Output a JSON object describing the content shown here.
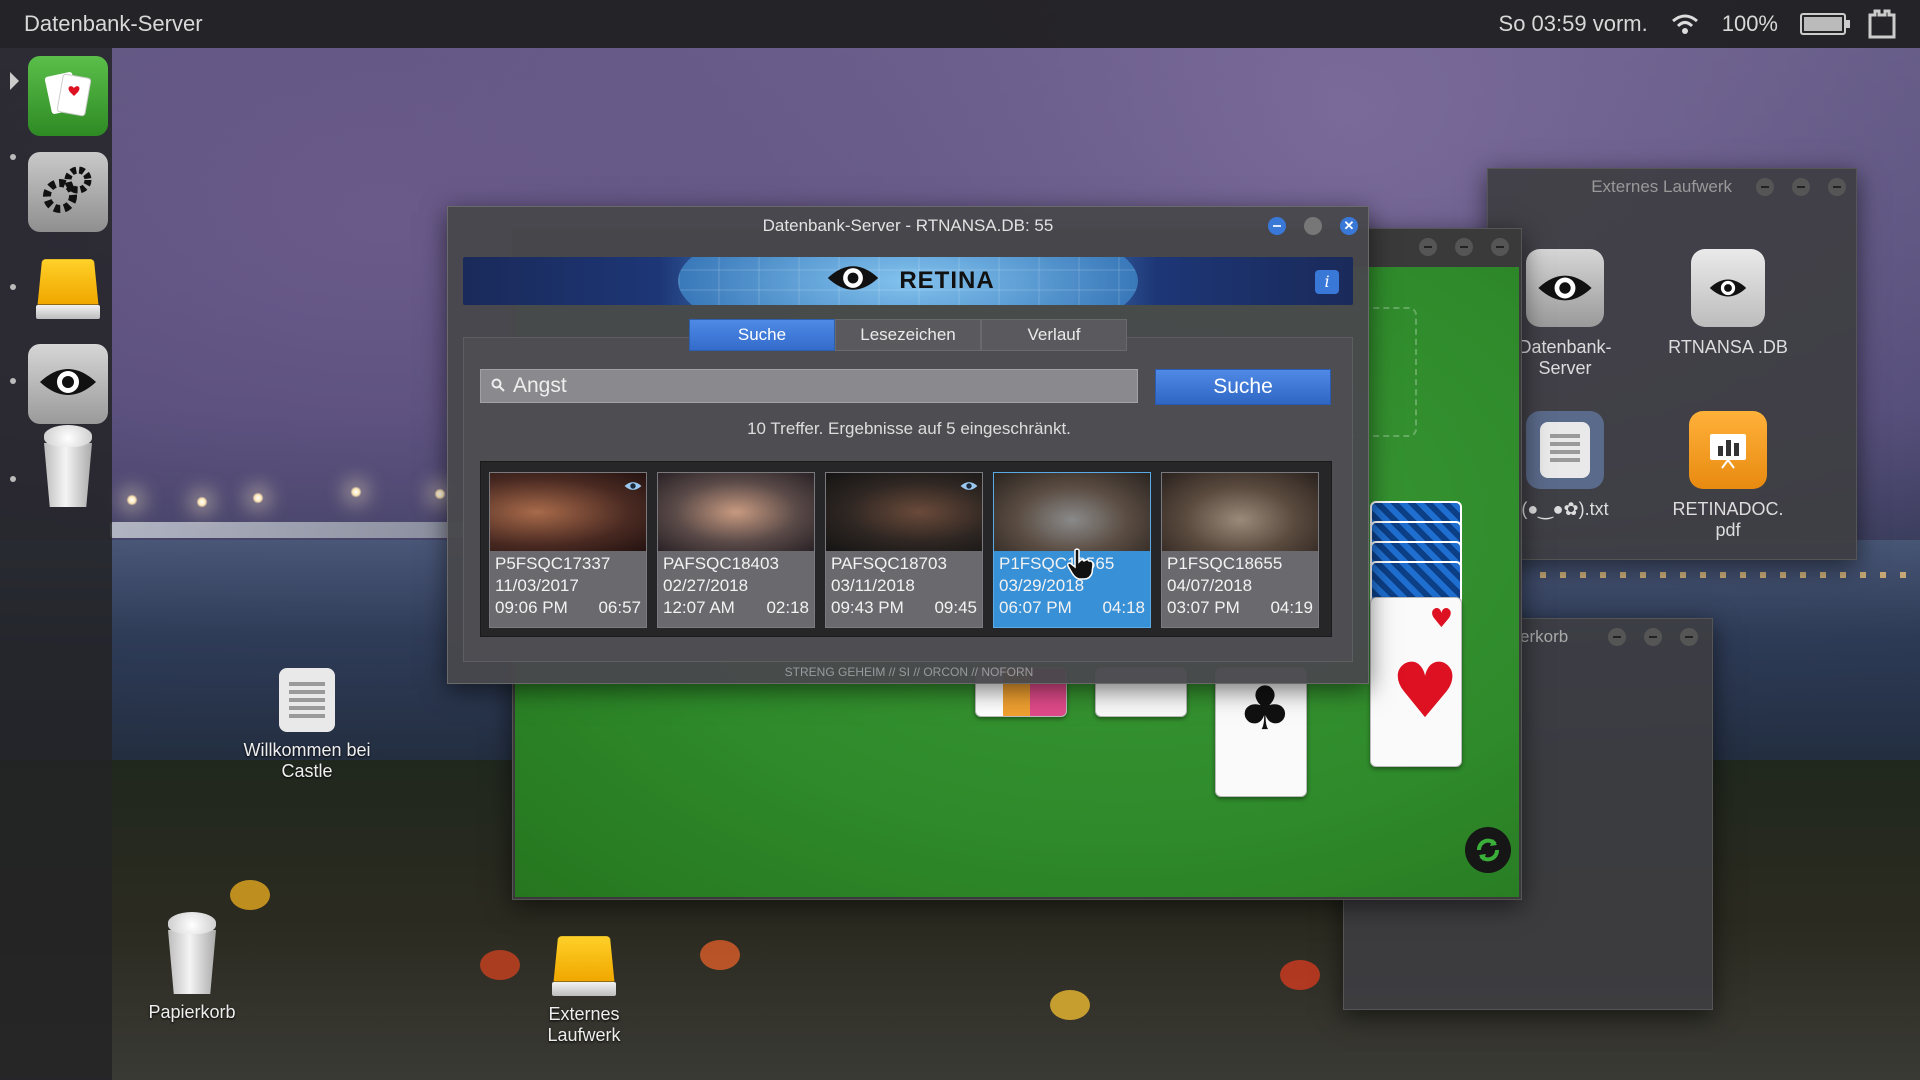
{
  "topbar": {
    "app_title": "Datenbank-Server",
    "clock": "So 03:59 vorm.",
    "battery_percent": "100%",
    "battery_level": 1.0
  },
  "dock": {
    "items": [
      {
        "name": "solitaire-app",
        "icon": "cards-icon"
      },
      {
        "name": "settings-app",
        "icon": "gears-icon"
      },
      {
        "name": "external-drive-app",
        "icon": "drive-icon"
      },
      {
        "name": "database-server-app",
        "icon": "eye-icon"
      },
      {
        "name": "trash-app",
        "icon": "trash-icon"
      }
    ]
  },
  "desktop": {
    "icons": [
      {
        "label": "Willkommen bei Castle",
        "icon": "document-icon"
      },
      {
        "label": "Papierkorb",
        "icon": "trash-icon"
      },
      {
        "label": "Externes Laufwerk",
        "icon": "drive-icon"
      }
    ]
  },
  "external_drive_window": {
    "title": "Externes Laufwerk",
    "items": [
      {
        "label": "Datenbank-Server",
        "icon": "eye-icon"
      },
      {
        "label": "RTNANSA .DB",
        "icon": "eye-document-icon"
      },
      {
        "label": "(●‿●✿).txt",
        "icon": "text-document-icon"
      },
      {
        "label": "RETINADOC. pdf",
        "icon": "chart-document-icon"
      }
    ]
  },
  "trash_window": {
    "title": "Papierkorb",
    "visible_title": "erkorb"
  },
  "db_window": {
    "title": "Datenbank-Server - RTNANSA.DB: 55",
    "brand": "RETINA",
    "info_label": "i",
    "tabs": [
      {
        "label": "Suche",
        "active": true
      },
      {
        "label": "Lesezeichen",
        "active": false
      },
      {
        "label": "Verlauf",
        "active": false
      }
    ],
    "search": {
      "value": "Angst",
      "placeholder": "",
      "button_label": "Suche"
    },
    "result_info": "10 Treffer. Ergebnisse auf 5 eingeschränkt.",
    "results": [
      {
        "id": "P5FSQC17337",
        "date": "11/03/2017",
        "time": "09:06 PM",
        "duration": "06:57",
        "viewed": true,
        "selected": false
      },
      {
        "id": "PAFSQC18403",
        "date": "02/27/2018",
        "time": "12:07 AM",
        "duration": "02:18",
        "viewed": false,
        "selected": false
      },
      {
        "id": "PAFSQC18703",
        "date": "03/11/2018",
        "time": "09:43 PM",
        "duration": "09:45",
        "viewed": true,
        "selected": false
      },
      {
        "id": "P1FSQC18565",
        "date": "03/29/2018",
        "time": "06:07 PM",
        "duration": "04:18",
        "viewed": false,
        "selected": true
      },
      {
        "id": "P1FSQC18655",
        "date": "04/07/2018",
        "time": "03:07 PM",
        "duration": "04:19",
        "viewed": false,
        "selected": false
      }
    ],
    "classification": "STRENG GEHEIM // SI // ORCON // NOFORN"
  },
  "colors": {
    "accent": "#3a78d8",
    "selected_result": "#3890d6",
    "felt": "#2e8a2a"
  }
}
